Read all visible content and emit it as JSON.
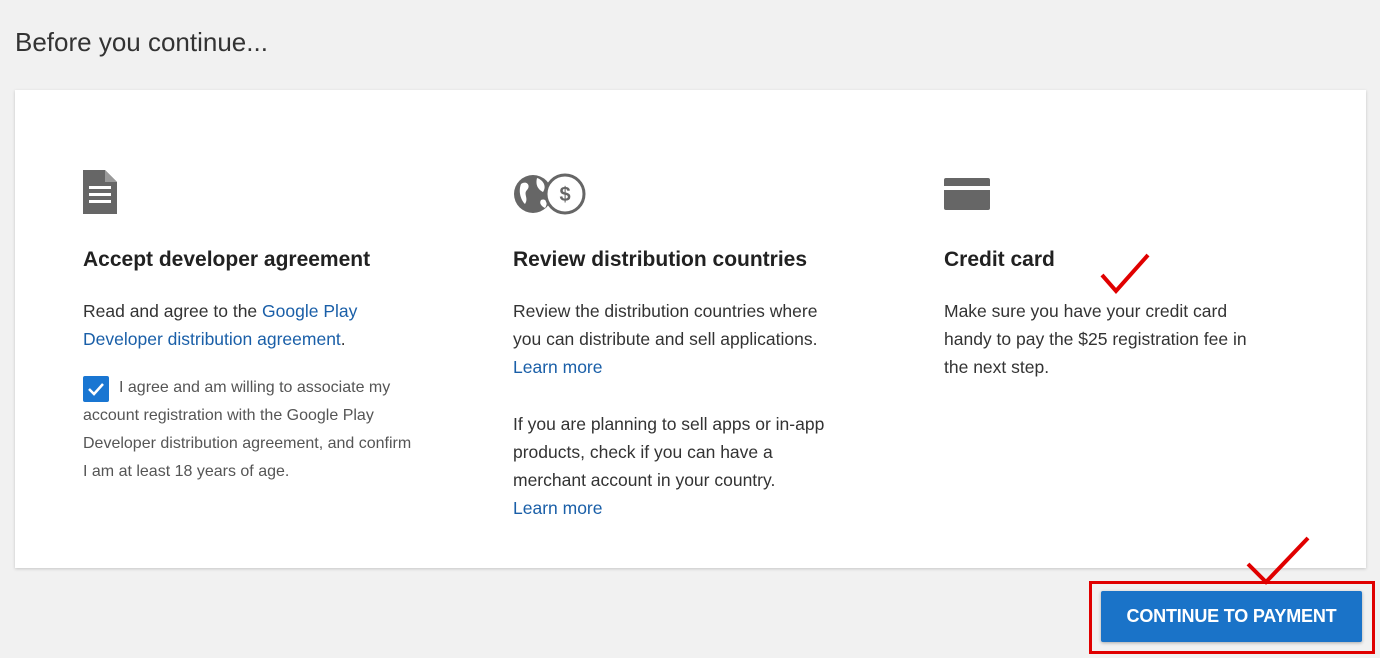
{
  "page": {
    "title": "Before you continue..."
  },
  "sections": {
    "agreement": {
      "icon": "document-icon",
      "heading": "Accept developer agreement",
      "text_before_link": "Read and agree to the ",
      "link": "Google Play Developer distribution agreement",
      "text_after_link": ".",
      "checkbox_checked": true,
      "checkbox_label": "I agree and am willing to associate my account registration with the Google Play Developer distribution agreement, and confirm I am at least 18 years of age."
    },
    "countries": {
      "icon": "globe-dollar-icon",
      "heading": "Review distribution countries",
      "para1": "Review the distribution countries where you can distribute and sell applications.",
      "learn_more_1": "Learn more",
      "para2": "If you are planning to sell apps or in-app products, check if you can have a merchant account in your country.",
      "learn_more_2": "Learn more"
    },
    "credit_card": {
      "icon": "credit-card-icon",
      "heading": "Credit card",
      "para": "Make sure you have your credit card handy to pay the $25 registration fee in the next step."
    }
  },
  "actions": {
    "continue_label": "CONTINUE TO PAYMENT"
  },
  "colors": {
    "accent": "#1a73c8",
    "link": "#1a5fa8",
    "annotation": "#e00000",
    "icon": "#666666"
  }
}
